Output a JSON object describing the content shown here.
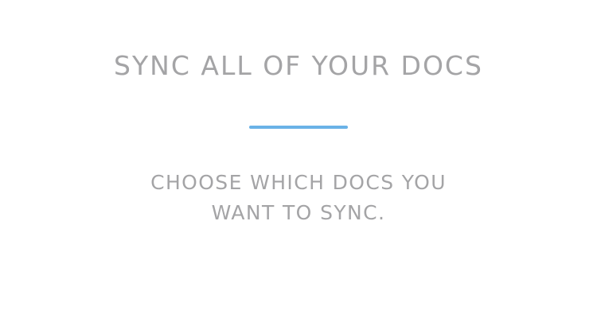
{
  "onboarding": {
    "title": "SYNC ALL OF YOUR DOCS",
    "subtitle_lines": [
      "CHOOSE WHICH DOCS YOU",
      "WANT TO SYNC."
    ]
  },
  "colors": {
    "background": "#ffffff",
    "text": "#a4a4a6",
    "accent": "#6ab2e7"
  }
}
